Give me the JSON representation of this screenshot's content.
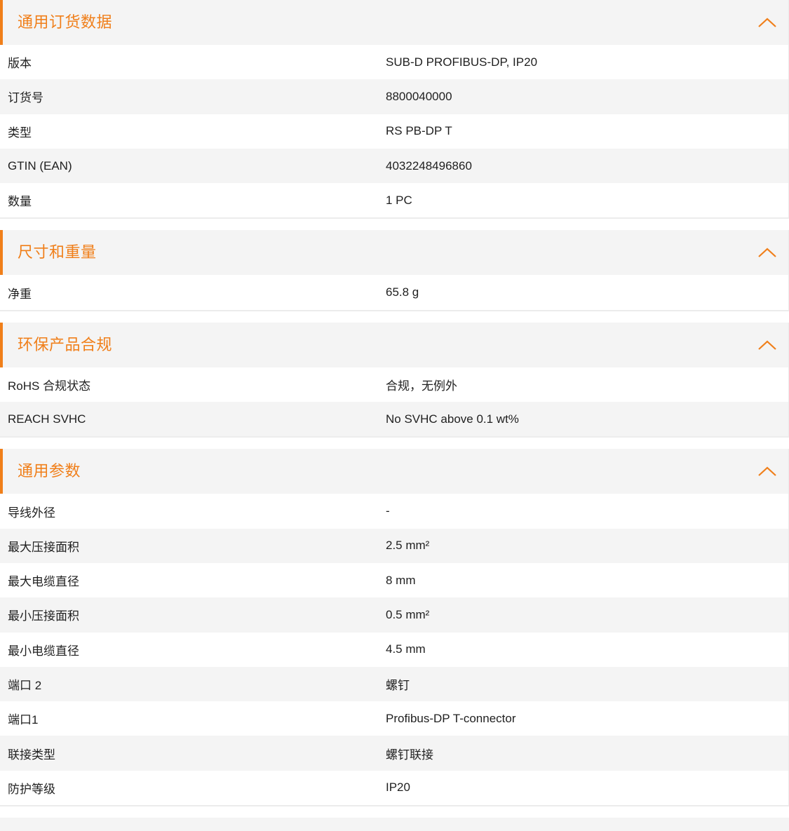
{
  "colors": {
    "accent": "#f07f1a",
    "header_bg": "#f4f4f4",
    "row_alt_bg": "#f4f4f4",
    "row_bg": "#ffffff"
  },
  "sections": [
    {
      "title": "通用订货数据",
      "toggle_icon": "chevron-up-icon",
      "rows": [
        {
          "label": "版本",
          "value": "SUB-D PROFIBUS-DP, IP20"
        },
        {
          "label": "订货号",
          "value": "8800040000"
        },
        {
          "label": "类型",
          "value": "RS PB-DP T"
        },
        {
          "label": "GTIN (EAN)",
          "value": "4032248496860"
        },
        {
          "label": "数量",
          "value": "1  PC"
        }
      ]
    },
    {
      "title": "尺寸和重量",
      "toggle_icon": "chevron-up-icon",
      "rows": [
        {
          "label": "净重",
          "value": "65.8  g"
        }
      ]
    },
    {
      "title": "环保产品合规",
      "toggle_icon": "chevron-up-icon",
      "rows": [
        {
          "label": "RoHS 合规状态",
          "value": "合规，无例外"
        },
        {
          "label": "REACH SVHC",
          "value": "No SVHC above 0.1 wt%"
        }
      ]
    },
    {
      "title": "通用参数",
      "toggle_icon": "chevron-up-icon",
      "rows": [
        {
          "label": "导线外径",
          "value": "-"
        },
        {
          "label": "最大压接面积",
          "value": "2.5  mm²"
        },
        {
          "label": "最大电缆直径",
          "value": "8  mm"
        },
        {
          "label": "最小压接面积",
          "value": "0.5  mm²"
        },
        {
          "label": "最小电缆直径",
          "value": "4.5  mm"
        },
        {
          "label": "端口 2",
          "value": "螺钉"
        },
        {
          "label": "端口1",
          "value": "Profibus-DP T-connector"
        },
        {
          "label": "联接类型",
          "value": "螺钉联接"
        },
        {
          "label": "防护等级",
          "value": "IP20"
        }
      ]
    }
  ]
}
